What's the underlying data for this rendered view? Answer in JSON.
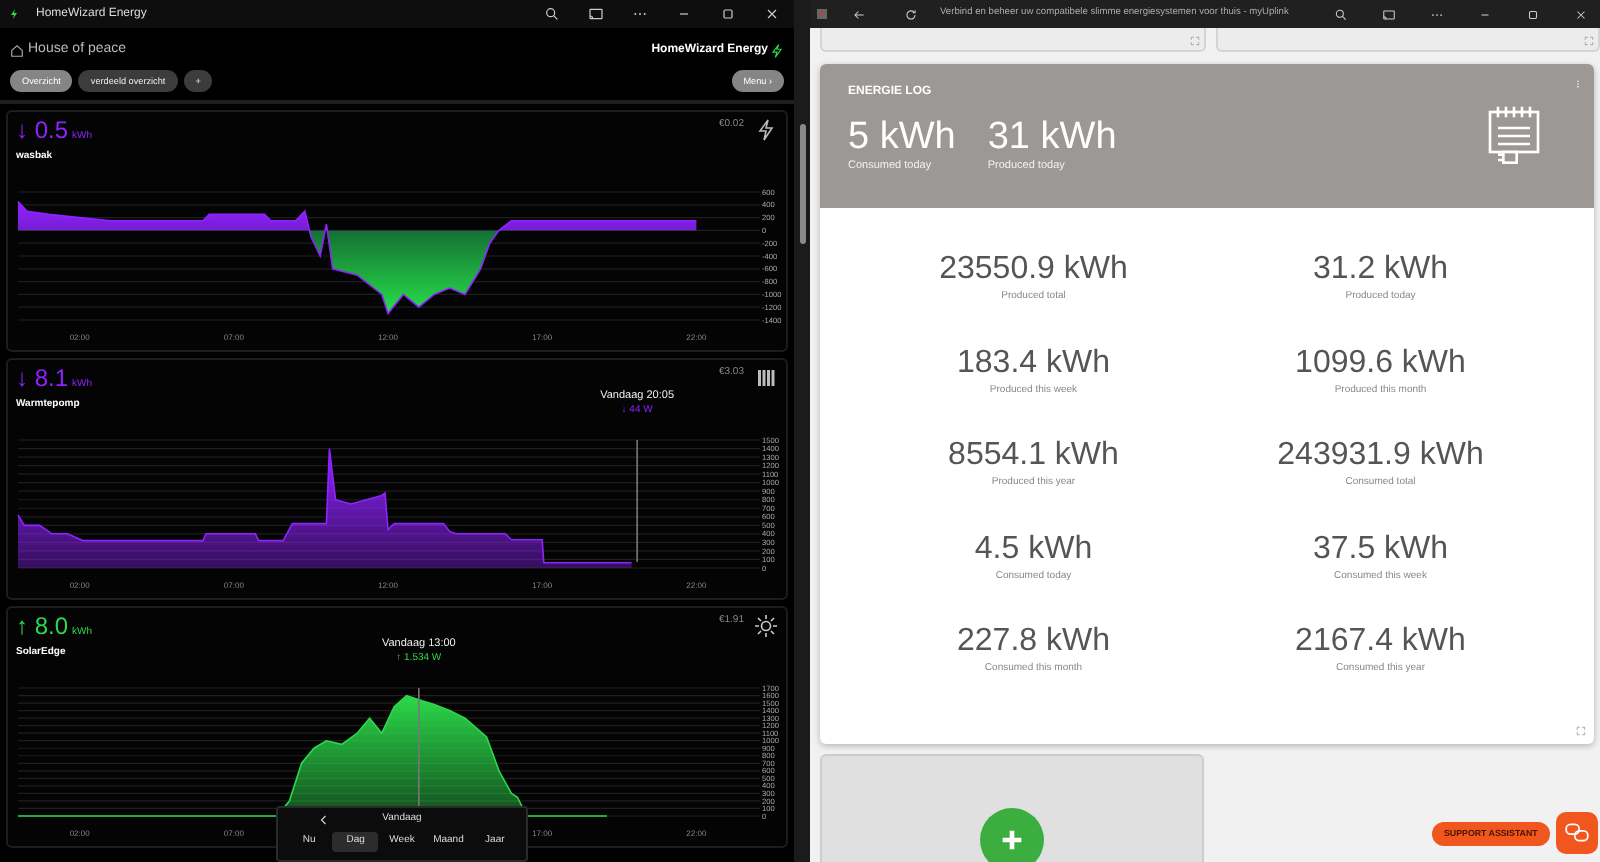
{
  "app_window": {
    "title": "HomeWizard Energy"
  },
  "home": {
    "name": "House of peace"
  },
  "logo": {
    "text": "HomeWizard Energy"
  },
  "tabs": [
    {
      "label": "Overzicht",
      "selected": true
    },
    {
      "label": "verdeeld overzicht",
      "selected": false
    },
    {
      "label": "+",
      "selected": false
    }
  ],
  "menu_button": {
    "label": "Menu ›"
  },
  "panels": [
    {
      "kind": "consumption",
      "arrow": "↓",
      "value": "0.5",
      "unit": "kWh",
      "name": "wasbak",
      "cost": "€0.02",
      "chart_data": {
        "type": "area",
        "grid": true,
        "x": [
          0,
          0.3,
          1,
          2,
          3,
          6,
          6.2,
          8,
          8.2,
          9,
          9.3,
          9.5,
          9.8,
          10,
          10.2,
          11,
          11.8,
          12,
          12.5,
          13,
          13.5,
          14,
          14.5,
          15,
          15.3,
          15.6,
          16,
          22
        ],
        "series": [
          {
            "color": "#8f22ff",
            "values": [
              450,
              300,
              250,
              200,
              150,
              150,
              250,
              250,
              150,
              150,
              300,
              -100,
              -400,
              100,
              -600,
              -700,
              -1000,
              -1300,
              -1000,
              -1200,
              -1000,
              -900,
              -1000,
              -600,
              -200,
              0,
              150,
              150
            ]
          }
        ],
        "xlim": [
          0,
          24
        ],
        "ylim": [
          -1400,
          600
        ],
        "xticks": [
          {
            "value": 2,
            "label": "02:00"
          },
          {
            "value": 7,
            "label": "07:00"
          },
          {
            "value": 12,
            "label": "12:00"
          },
          {
            "value": 17,
            "label": "17:00"
          },
          {
            "value": 22,
            "label": "22:00"
          }
        ],
        "yticks": [
          600,
          400,
          200,
          0,
          -200,
          -400,
          -600,
          -800,
          -1000,
          -1200,
          -1400
        ]
      }
    },
    {
      "kind": "consumption",
      "arrow": "↓",
      "value": "8.1",
      "unit": "kWh",
      "name": "Warmtepomp",
      "cost": "€3.03",
      "tooltip": {
        "time": "Vandaag 20:05",
        "reading": "↓ 44 W"
      },
      "chart_data": {
        "type": "area",
        "grid": true,
        "x": [
          0,
          0.2,
          0.7,
          1.1,
          1.6,
          2.1,
          6,
          6.1,
          7.7,
          7.8,
          8.6,
          8.9,
          10,
          10.1,
          10.3,
          10.8,
          11.8,
          11.9,
          12,
          12.2,
          13.8,
          14,
          14.2,
          15.8,
          16,
          17,
          17.05,
          19.9
        ],
        "series": [
          {
            "color": "#8f22ff",
            "values": [
              620,
              500,
              500,
              400,
              400,
              320,
              320,
              400,
              400,
              320,
              320,
              520,
              520,
              1400,
              800,
              750,
              850,
              880,
              450,
              520,
              520,
              430,
              400,
              400,
              330,
              330,
              60,
              60
            ]
          }
        ],
        "xlim": [
          0,
          24
        ],
        "ylim": [
          0,
          1500
        ],
        "xticks": [
          {
            "value": 2,
            "label": "02:00"
          },
          {
            "value": 7,
            "label": "07:00"
          },
          {
            "value": 12,
            "label": "12:00"
          },
          {
            "value": 17,
            "label": "17:00"
          },
          {
            "value": 22,
            "label": "22:00"
          }
        ],
        "yticks": [
          1500,
          1400,
          1300,
          1200,
          1100,
          1000,
          900,
          800,
          700,
          600,
          500,
          400,
          300,
          200,
          100,
          0
        ],
        "ref_lines": [
          {
            "axis": "x",
            "value": 20.08
          }
        ]
      }
    },
    {
      "kind": "production",
      "arrow": "↑",
      "value": "8.0",
      "unit": "kWh",
      "name": "SolarEdge",
      "cost": "€1.91",
      "tooltip": {
        "time": "Vandaag 13:00",
        "reading": "↑ 1.534 W"
      },
      "chart_data": {
        "type": "area",
        "grid": true,
        "x": [
          0,
          8.4,
          8.8,
          9.2,
          9.6,
          10,
          10.5,
          11,
          11.4,
          11.8,
          12.2,
          12.6,
          13.1,
          13.5,
          14,
          14.5,
          15.2,
          15.6,
          16,
          16.2,
          16.5,
          19.1
        ],
        "series": [
          {
            "color": "#2bd94a",
            "values": [
              0,
              0,
              200,
              700,
              900,
              1000,
              950,
              1100,
              1300,
              1100,
              1450,
              1600,
              1530,
              1480,
              1400,
              1300,
              1050,
              600,
              300,
              250,
              0,
              0
            ]
          }
        ],
        "xlim": [
          0,
          24
        ],
        "ylim": [
          0,
          1700
        ],
        "xticks": [
          {
            "value": 2,
            "label": "02:00"
          },
          {
            "value": 7,
            "label": "07:00"
          },
          {
            "value": 17,
            "label": "17:00"
          },
          {
            "value": 22,
            "label": "22:00"
          }
        ],
        "yticks": [
          1700,
          1600,
          1500,
          1400,
          1300,
          1200,
          1100,
          1000,
          900,
          800,
          700,
          600,
          500,
          400,
          300,
          200,
          100,
          0
        ],
        "ref_lines": [
          {
            "axis": "x",
            "value": 13
          }
        ]
      }
    }
  ],
  "date_nav": {
    "label": "Vandaag",
    "periods": [
      {
        "label": "Nu",
        "selected": false
      },
      {
        "label": "Dag",
        "selected": true
      },
      {
        "label": "Week",
        "selected": false
      },
      {
        "label": "Maand",
        "selected": false
      },
      {
        "label": "Jaar",
        "selected": false
      }
    ]
  },
  "browser": {
    "title": "Verbind en beheer uw compatibele slimme energiesystemen voor thuis - myUplink"
  },
  "energy_log": {
    "title": "ENERGIE LOG",
    "summary": [
      {
        "value": "5 kWh",
        "label": "Consumed today"
      },
      {
        "value": "31 kWh",
        "label": "Produced today"
      }
    ],
    "stats": [
      {
        "value": "23550.9 kWh",
        "label": "Produced total"
      },
      {
        "value": "31.2 kWh",
        "label": "Produced today"
      },
      {
        "value": "183.4 kWh",
        "label": "Produced this week"
      },
      {
        "value": "1099.6 kWh",
        "label": "Produced this month"
      },
      {
        "value": "8554.1 kWh",
        "label": "Produced this year"
      },
      {
        "value": "243931.9 kWh",
        "label": "Consumed total"
      },
      {
        "value": "4.5 kWh",
        "label": "Consumed today"
      },
      {
        "value": "37.5 kWh",
        "label": "Consumed this week"
      },
      {
        "value": "227.8 kWh",
        "label": "Consumed this month"
      },
      {
        "value": "2167.4 kWh",
        "label": "Consumed this year"
      }
    ]
  },
  "support": {
    "label": "SUPPORT ASSISTANT"
  }
}
